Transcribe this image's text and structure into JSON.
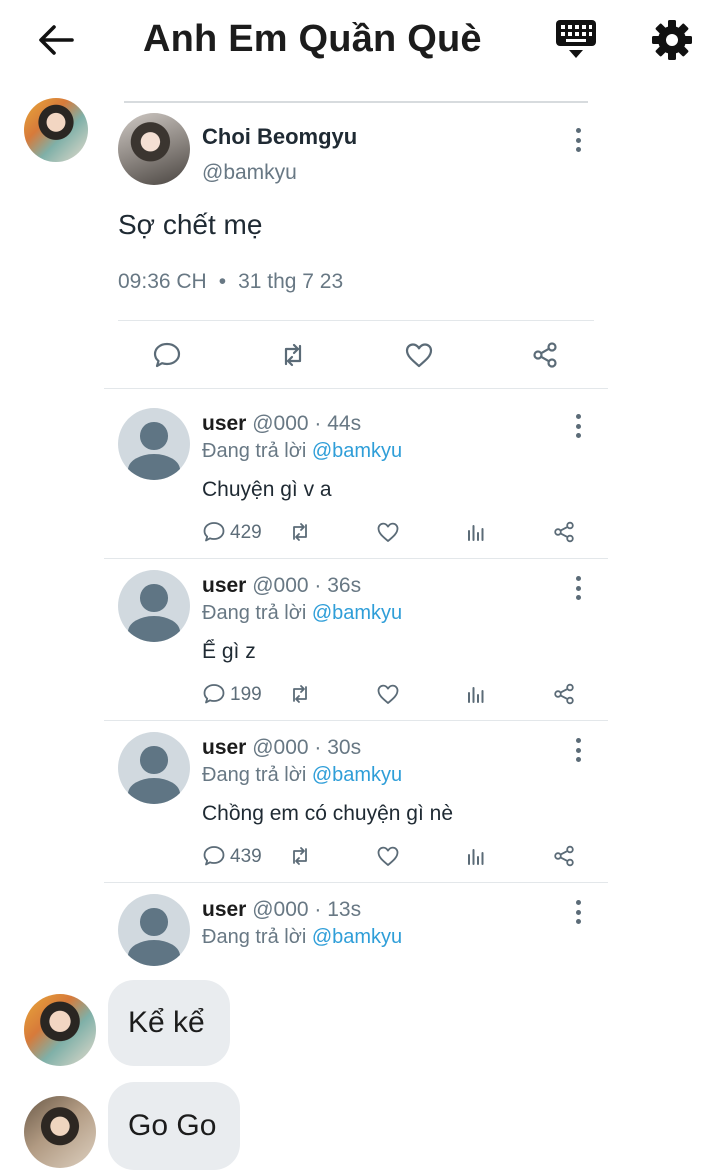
{
  "header": {
    "title": "Anh Em Quần Què",
    "back_icon": "arrow-left-icon",
    "keyboard_icon": "keyboard-icon",
    "settings_icon": "gear-icon"
  },
  "main_tweet": {
    "author": "Choi Beomgyu",
    "handle": "@bamkyu",
    "text": "Sợ chết mẹ",
    "time": "09:36 CH",
    "date": "31 thg 7 23",
    "actions": [
      "reply-icon",
      "retweet-icon",
      "heart-icon",
      "share-icon"
    ]
  },
  "replies": [
    {
      "name": "user",
      "meta": "@000 · 44s",
      "replying_prefix": "Đang trả lời",
      "mention": "@bamkyu",
      "text": "Chuyện gì v a",
      "reply_count": "429"
    },
    {
      "name": "user",
      "meta": "@000 · 36s",
      "replying_prefix": "Đang trả lời",
      "mention": "@bamkyu",
      "text": "Ể gì z",
      "reply_count": "199"
    },
    {
      "name": "user",
      "meta": "@000 · 30s",
      "replying_prefix": "Đang trả lời",
      "mention": "@bamkyu",
      "text": "Chồng em có chuyện gì nè",
      "reply_count": "439"
    },
    {
      "name": "user",
      "meta": "@000 · 13s",
      "replying_prefix": "Đang trả lời",
      "mention": "@bamkyu"
    }
  ],
  "messages": [
    {
      "text": "Kể kể"
    },
    {
      "text": "Go Go"
    }
  ],
  "colors": {
    "mention": "#2f9ed8",
    "secondary_text": "#687884",
    "bubble": "#e9ecef"
  }
}
